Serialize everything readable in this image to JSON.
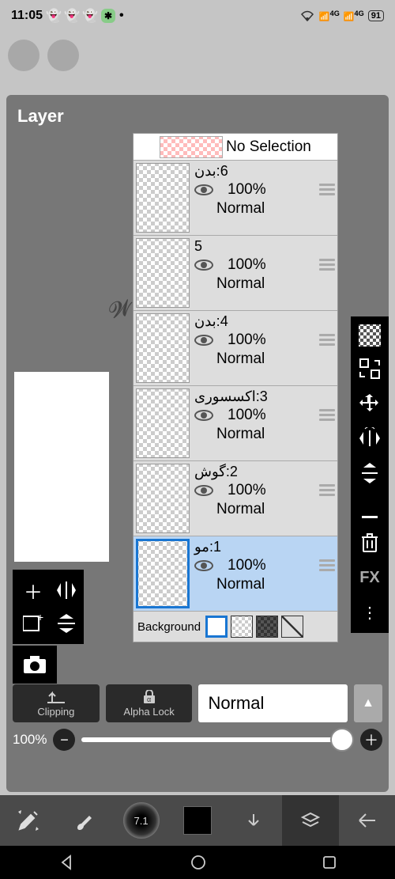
{
  "status": {
    "time": "11:05",
    "battery": "91",
    "net1": "4G",
    "net2": "4G"
  },
  "panel": {
    "title": "Layer",
    "no_selection": "No Selection"
  },
  "layers": [
    {
      "name": "6:بدن",
      "opacity": "100%",
      "blend": "Normal"
    },
    {
      "name": "5",
      "opacity": "100%",
      "blend": "Normal"
    },
    {
      "name": "4:بدن",
      "opacity": "100%",
      "blend": "Normal"
    },
    {
      "name": "3:اكسسورى",
      "opacity": "100%",
      "blend": "Normal"
    },
    {
      "name": "2:گوش",
      "opacity": "100%",
      "blend": "Normal"
    },
    {
      "name": "1:مو",
      "opacity": "100%",
      "blend": "Normal"
    }
  ],
  "bg_label": "Background",
  "controls": {
    "clipping": "Clipping",
    "alpha": "Alpha Lock",
    "blend": "Normal",
    "opacity": "100%"
  },
  "fx": "FX",
  "brush": "7.1"
}
